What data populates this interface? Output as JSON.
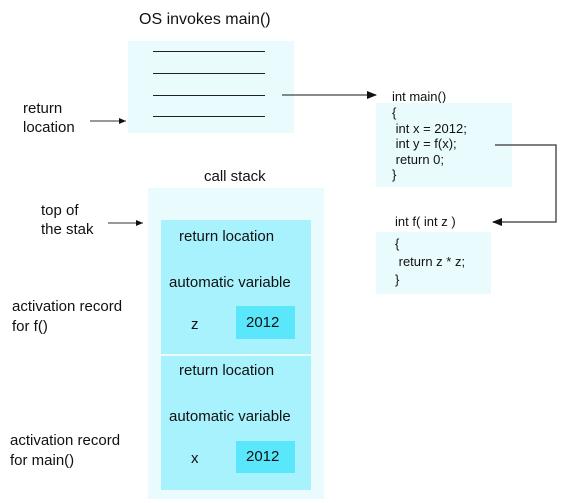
{
  "os": {
    "title": "OS invokes main()",
    "return_label_line1": "return",
    "return_label_line2": "location"
  },
  "main_func": {
    "signature": "int main()",
    "lines": [
      "{",
      " int x = 2012;",
      " int y = f(x);",
      " return 0;",
      "}"
    ]
  },
  "f_func": {
    "signature": "int f( int z )",
    "lines": [
      "{",
      " return z * z;",
      "}"
    ]
  },
  "call_stack": {
    "title": "call stack",
    "top_label_line1": "top of",
    "top_label_line2": "the stak",
    "records": [
      {
        "label_line1": "activation record",
        "label_line2": "for f()",
        "return_location": "return location",
        "automatic_variable": "automatic variable",
        "var_name": "z",
        "var_value": "2012"
      },
      {
        "label_line1": "activation record",
        "label_line2": "for main()",
        "return_location": "return location",
        "automatic_variable": "automatic variable",
        "var_name": "x",
        "var_value": "2012"
      }
    ]
  },
  "colors": {
    "light_box": "#eafbfe",
    "record_box": "#a8f2fe",
    "value_box": "#5ae6fb"
  }
}
